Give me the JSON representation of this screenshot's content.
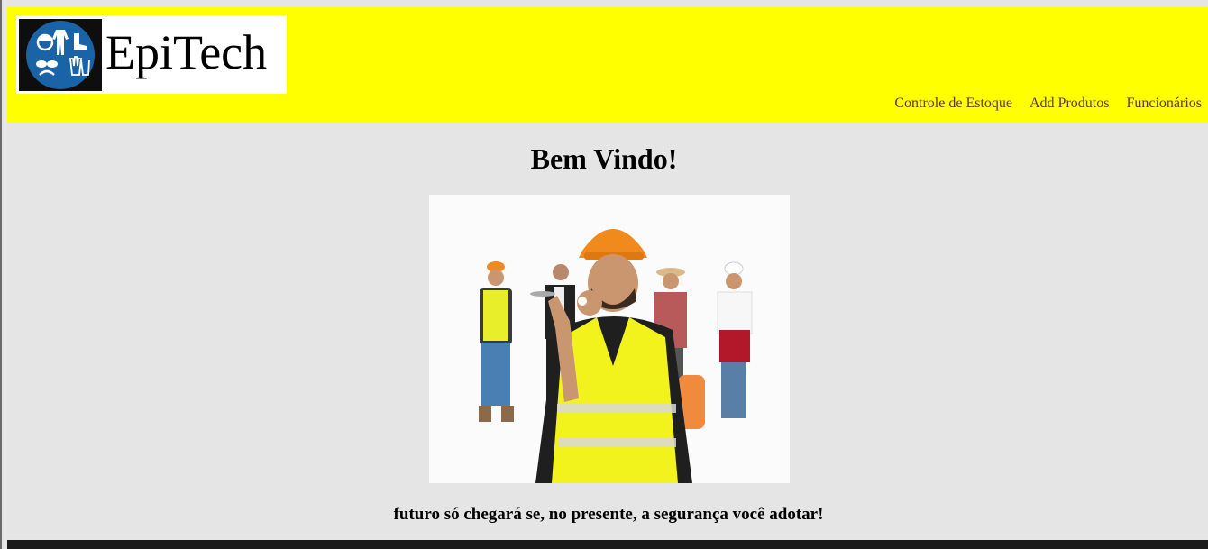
{
  "header": {
    "logo_text": "EpiTech",
    "logo_icon": "safety-equipment-icon",
    "background_color": "#ffff00"
  },
  "nav": {
    "items": [
      {
        "label": "Controle de Estoque"
      },
      {
        "label": "Add Produtos"
      },
      {
        "label": "Funcionários"
      }
    ]
  },
  "main": {
    "title": "Bem Vindo!",
    "tagline": "futuro só chegará se, no presente, a segurança você adotar!"
  },
  "colors": {
    "page_background": "#e5e5e5",
    "nav_link": "#5a3a3a",
    "footer": "#1b1b1b",
    "vest_yellow": "#f2f21c",
    "helmet_orange": "#f08a1c"
  }
}
